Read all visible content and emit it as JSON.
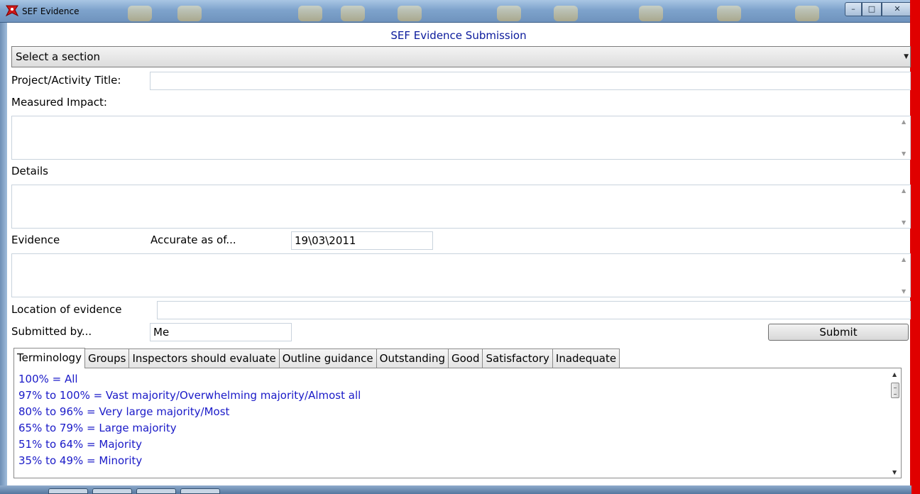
{
  "window": {
    "title": "SEF Evidence",
    "min_label": "–",
    "max_label": "□",
    "close_label": "✕",
    "accent_color": "#e00000"
  },
  "form": {
    "heading": "SEF Evidence Submission",
    "section_select": {
      "value": "Select a section",
      "icon": "chevron-down-icon"
    },
    "project_title_label": "Project/Activity Title:",
    "project_title_value": "",
    "measured_impact_label": "Measured Impact:",
    "details_label": "Details",
    "evidence_label": "Evidence",
    "accurate_as_of_label": "Accurate as of...",
    "accurate_as_of_value": "19\\03\\2011",
    "location_label": "Location of evidence",
    "location_value": "",
    "submitted_by_label": "Submitted by...",
    "submitted_by_value": "Me",
    "submit_label": "Submit"
  },
  "tabs": [
    {
      "label": "Terminology",
      "active": true
    },
    {
      "label": "Groups"
    },
    {
      "label": "Inspectors should evaluate"
    },
    {
      "label": "Outline guidance"
    },
    {
      "label": "Outstanding"
    },
    {
      "label": "Good"
    },
    {
      "label": "Satisfactory"
    },
    {
      "label": "Inadequate"
    }
  ],
  "terminology": [
    "100% = All",
    "97% to 100% = Vast majority/Overwhelming majority/Almost all",
    "80% to 96% = Very large majority/Most",
    "65% to 79% = Large majority",
    "51% to 64% = Majority",
    "35% to 49% = Minority"
  ]
}
